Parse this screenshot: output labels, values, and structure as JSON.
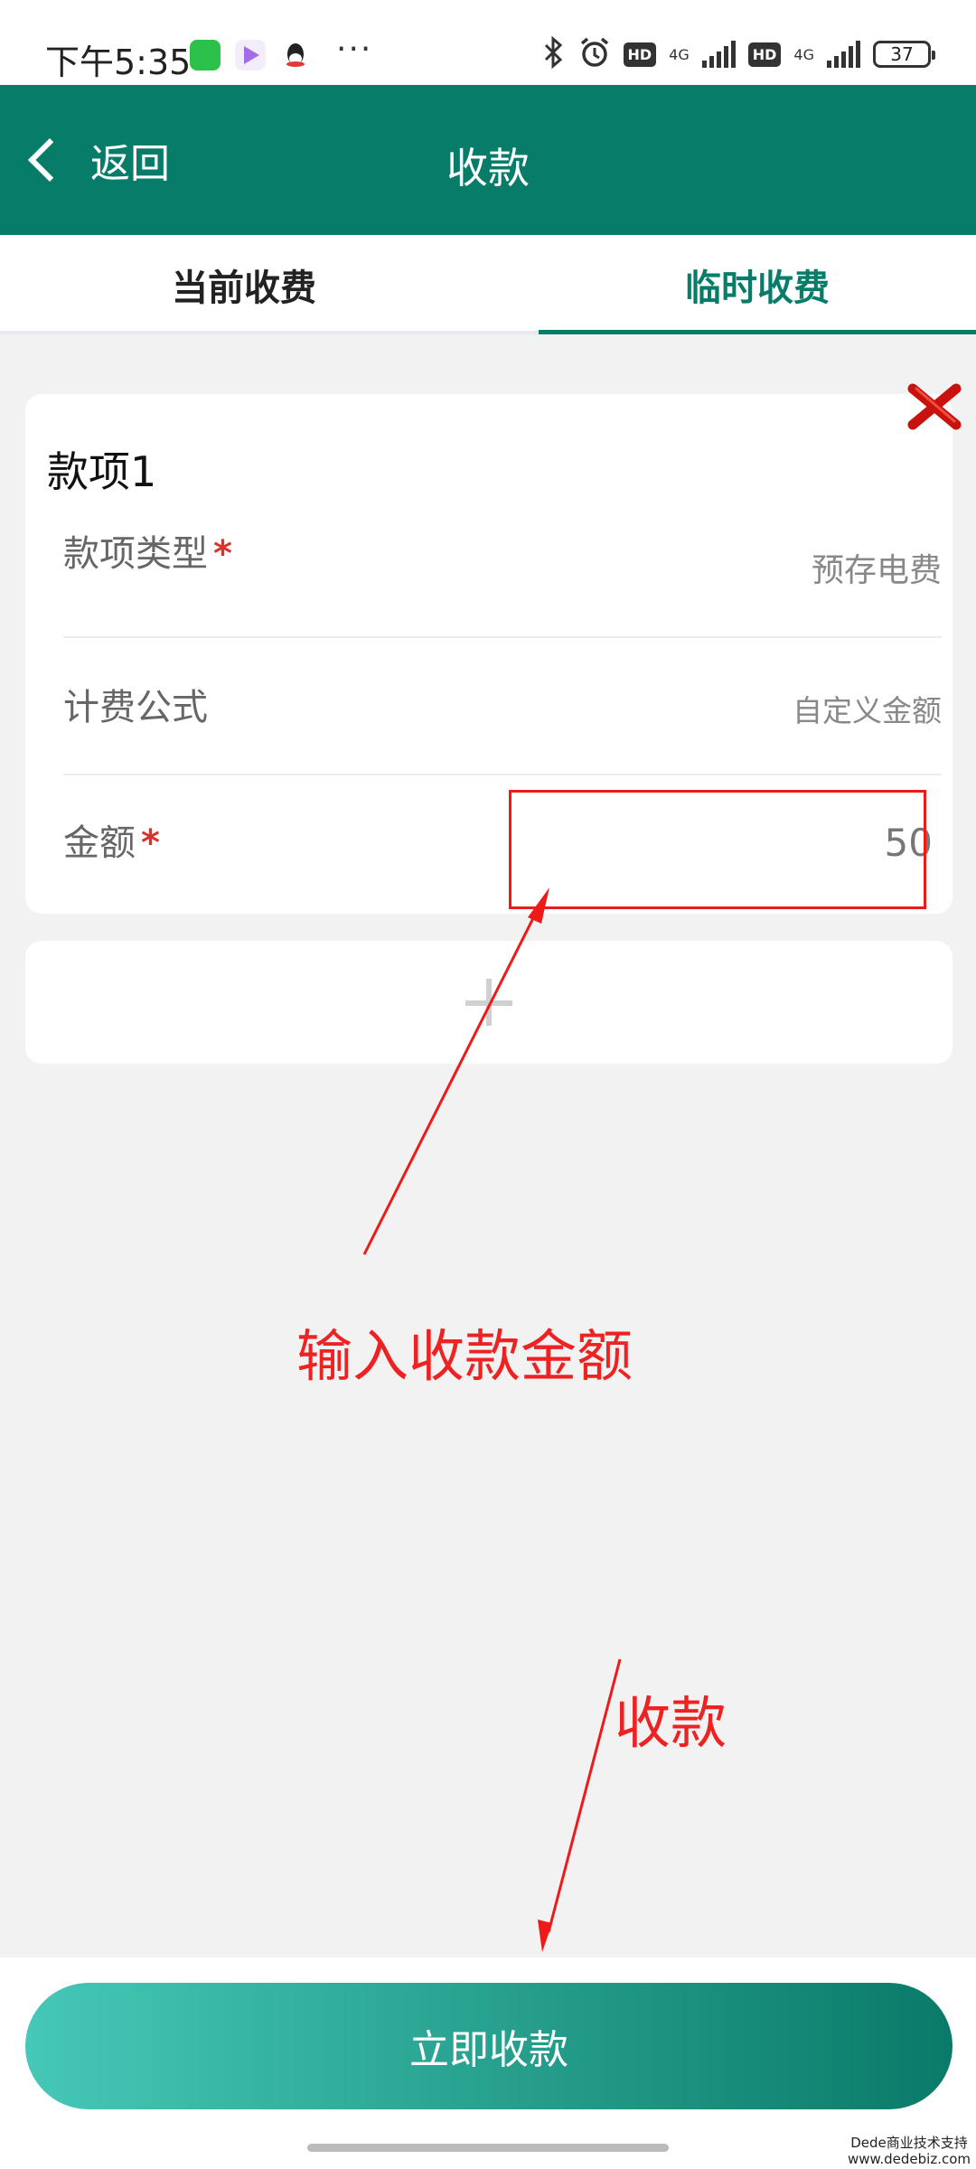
{
  "status_bar": {
    "time": "下午5:35",
    "network_1": "4G",
    "network_2": "4G",
    "hd_1": "HD",
    "hd_2": "HD",
    "battery": "37"
  },
  "header": {
    "back_label": "返回",
    "title": "收款"
  },
  "tabs": {
    "current": "当前收费",
    "temporary": "临时收费",
    "active": "temporary"
  },
  "item": {
    "title": "款项1",
    "type_label": "款项类型",
    "type_value": "预存电费",
    "formula_label": "计费公式",
    "formula_value": "自定义金额",
    "amount_label": "金额",
    "amount_value": "50",
    "required_mark": "*"
  },
  "annotations": {
    "input_hint": "输入收款金额",
    "pay_hint": "收款"
  },
  "footer": {
    "pay_button_label": "立即收款"
  },
  "watermark": {
    "line1": "Dede商业技术支持",
    "line2": "www.dedebiz.com"
  },
  "colors": {
    "brand": "#077c69",
    "annotation": "#ee1a1a",
    "required": "#d9332b"
  }
}
